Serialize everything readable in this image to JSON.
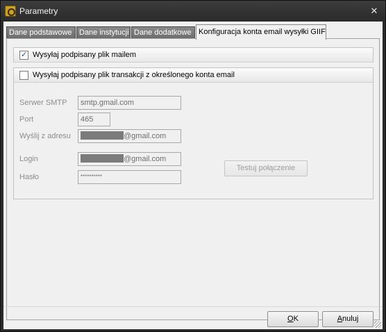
{
  "window": {
    "title": "Parametry",
    "close_glyph": "✕",
    "icon": "app-key-icon"
  },
  "tabs": [
    {
      "label": "Dane podstawowe",
      "active": false
    },
    {
      "label": "Dane instytucji",
      "active": false
    },
    {
      "label": "Dane dodatkowe",
      "active": false
    },
    {
      "label": "Konfiguracja konta email wysyłki GIIF",
      "active": true
    }
  ],
  "options": {
    "send_signed_by_mail": {
      "label": "Wysyłaj podpisany plik mailem",
      "checked": true,
      "tick": "✓"
    },
    "send_from_account": {
      "label": "Wysyłaj podpisany plik transakcji z określonego konta email",
      "checked": false
    }
  },
  "smtp": {
    "server_label": "Serwer SMTP",
    "server_value": "smtp.gmail.com",
    "port_label": "Port",
    "port_value": "465",
    "from_label": "Wyślij z adresu",
    "from_value_suffix": "@gmail.com",
    "login_label": "Login",
    "login_value_suffix": "@gmail.com",
    "password_label": "Hasło",
    "password_value": "**********",
    "test_button": "Testuj połączenie"
  },
  "footer": {
    "ok_label": "OK",
    "ok_underline": "O",
    "ok_rest": "K",
    "cancel_underline": "A",
    "cancel_rest": "nuluj"
  }
}
